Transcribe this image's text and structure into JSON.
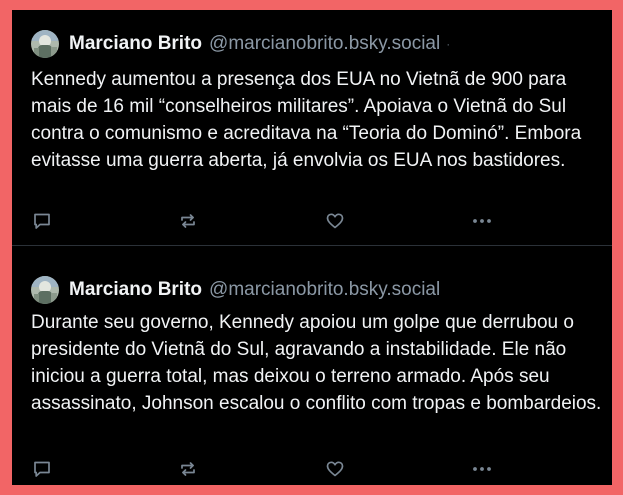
{
  "colors": {
    "border": "#f26566",
    "background": "#000000",
    "text": "#f1f3f5",
    "handle": "#8b98a5",
    "icon": "#7a8794",
    "divider": "#2b3138"
  },
  "posts": [
    {
      "author_name": "Marciano Brito",
      "author_handle": "@marcianobrito.bsky.social",
      "text": "Kennedy aumentou a presença dos EUA no Vietnã de 900 para mais de 16 mil “conselheiros militares”. Apoiava o Vietnã do Sul contra o comunismo e acreditava na “Teoria do Dominó”. Embora evitasse uma guerra aberta, já envolvia os EUA nos bastidores.",
      "actions": [
        "reply-icon",
        "repost-icon",
        "like-icon",
        "more-icon"
      ]
    },
    {
      "author_name": "Marciano Brito",
      "author_handle": "@marcianobrito.bsky.social",
      "text": "Durante seu governo, Kennedy apoiou um golpe que derrubou o presidente do Vietnã do Sul, agravando a instabilidade. Ele não iniciou a guerra total, mas deixou o terreno armado. Após seu assassinato, Johnson escalou o conflito com tropas e bombardeios.",
      "actions": [
        "reply-icon",
        "repost-icon",
        "like-icon",
        "more-icon"
      ]
    }
  ]
}
